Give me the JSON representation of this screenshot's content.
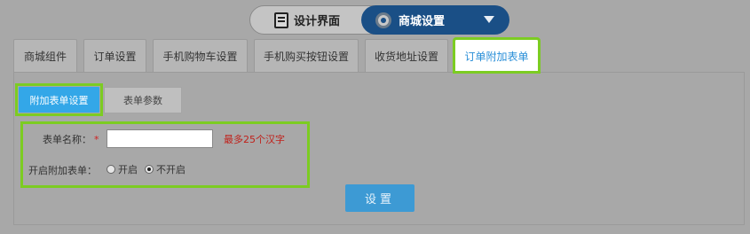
{
  "header": {
    "design_label": "设计界面",
    "mall_label": "商城设置"
  },
  "tabs": [
    {
      "label": "商城组件"
    },
    {
      "label": "订单设置"
    },
    {
      "label": "手机购物车设置"
    },
    {
      "label": "手机购买按钮设置"
    },
    {
      "label": "收货地址设置"
    },
    {
      "label": "订单附加表单"
    }
  ],
  "subtabs": {
    "active_label": "附加表单设置",
    "params_label": "表单参数"
  },
  "form": {
    "name_label": "表单名称：",
    "required_mark": "*",
    "name_value": "",
    "name_hint": "最多25个汉字",
    "toggle_label": "开启附加表单：",
    "option_on": "开启",
    "option_off": "不开启",
    "selected": "不开启"
  },
  "submit_label": "设置",
  "colors": {
    "accent": "#33a7e8",
    "highlight": "#7ccc22",
    "hint": "#c0201a",
    "mall_button": "#1a4f86"
  }
}
